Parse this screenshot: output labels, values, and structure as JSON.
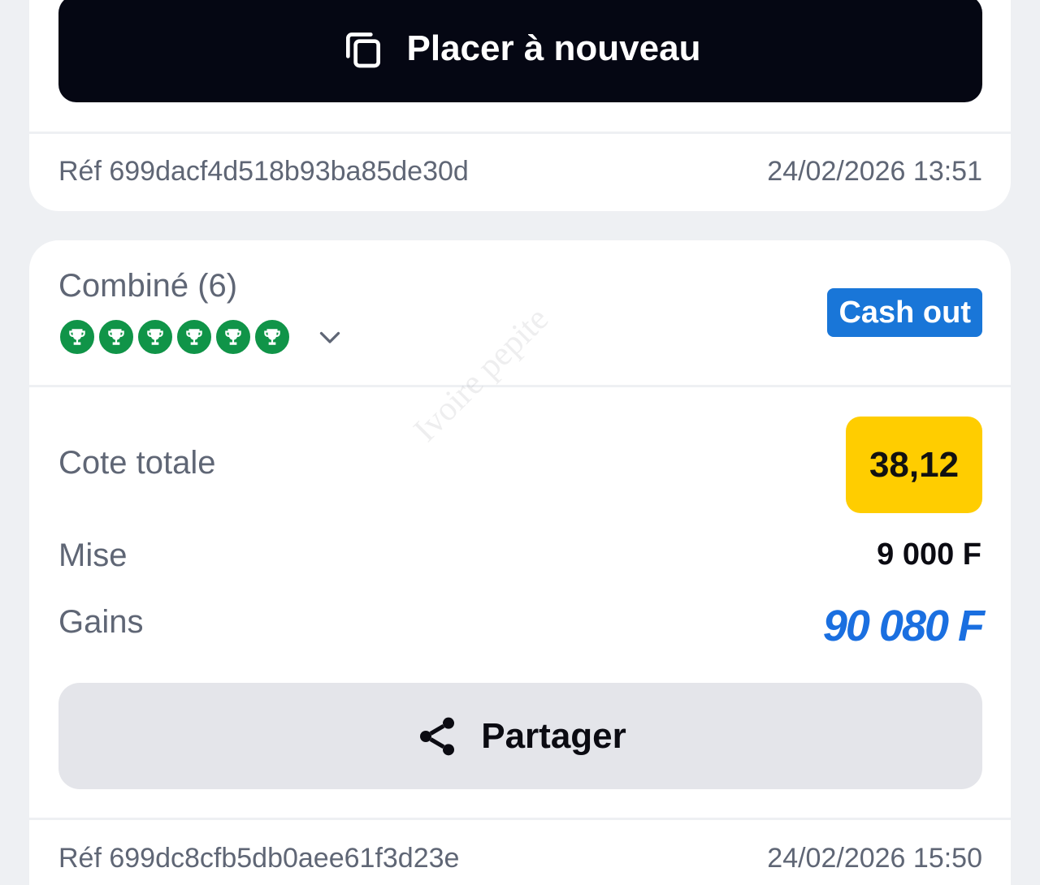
{
  "top_card": {
    "replace_button_label": "Placer à nouveau",
    "ref_label": "Réf 699dacf4d518b93ba85de30d",
    "timestamp": "24/02/2026 13:51"
  },
  "bet_card": {
    "title": "Combiné (6)",
    "selections": [
      {
        "status": "won",
        "icon": "trophy-icon"
      },
      {
        "status": "won",
        "icon": "trophy-icon"
      },
      {
        "status": "won",
        "icon": "trophy-icon"
      },
      {
        "status": "won",
        "icon": "trophy-icon"
      },
      {
        "status": "won",
        "icon": "trophy-icon"
      },
      {
        "status": "won",
        "icon": "trophy-icon"
      }
    ],
    "cashout_label": "Cash out",
    "total_odds_label": "Cote totale",
    "total_odds_value": "38,12",
    "stake_label": "Mise",
    "stake_value": "9 000 F",
    "winnings_label": "Gains",
    "winnings_value": "90 080 F",
    "share_button_label": "Partager",
    "ref_label": "Réf 699dc8cfb5db0aee61f3d23e",
    "timestamp": "24/02/2026 15:50"
  },
  "watermark": "Ivoire pepite",
  "colors": {
    "primary_button_bg": "#050713",
    "cashout_bg": "#1976d8",
    "odds_badge_bg": "#ffcd00",
    "won_green": "#109448",
    "winnings_blue": "#1a6fe0",
    "page_bg": "#eef0f3"
  }
}
